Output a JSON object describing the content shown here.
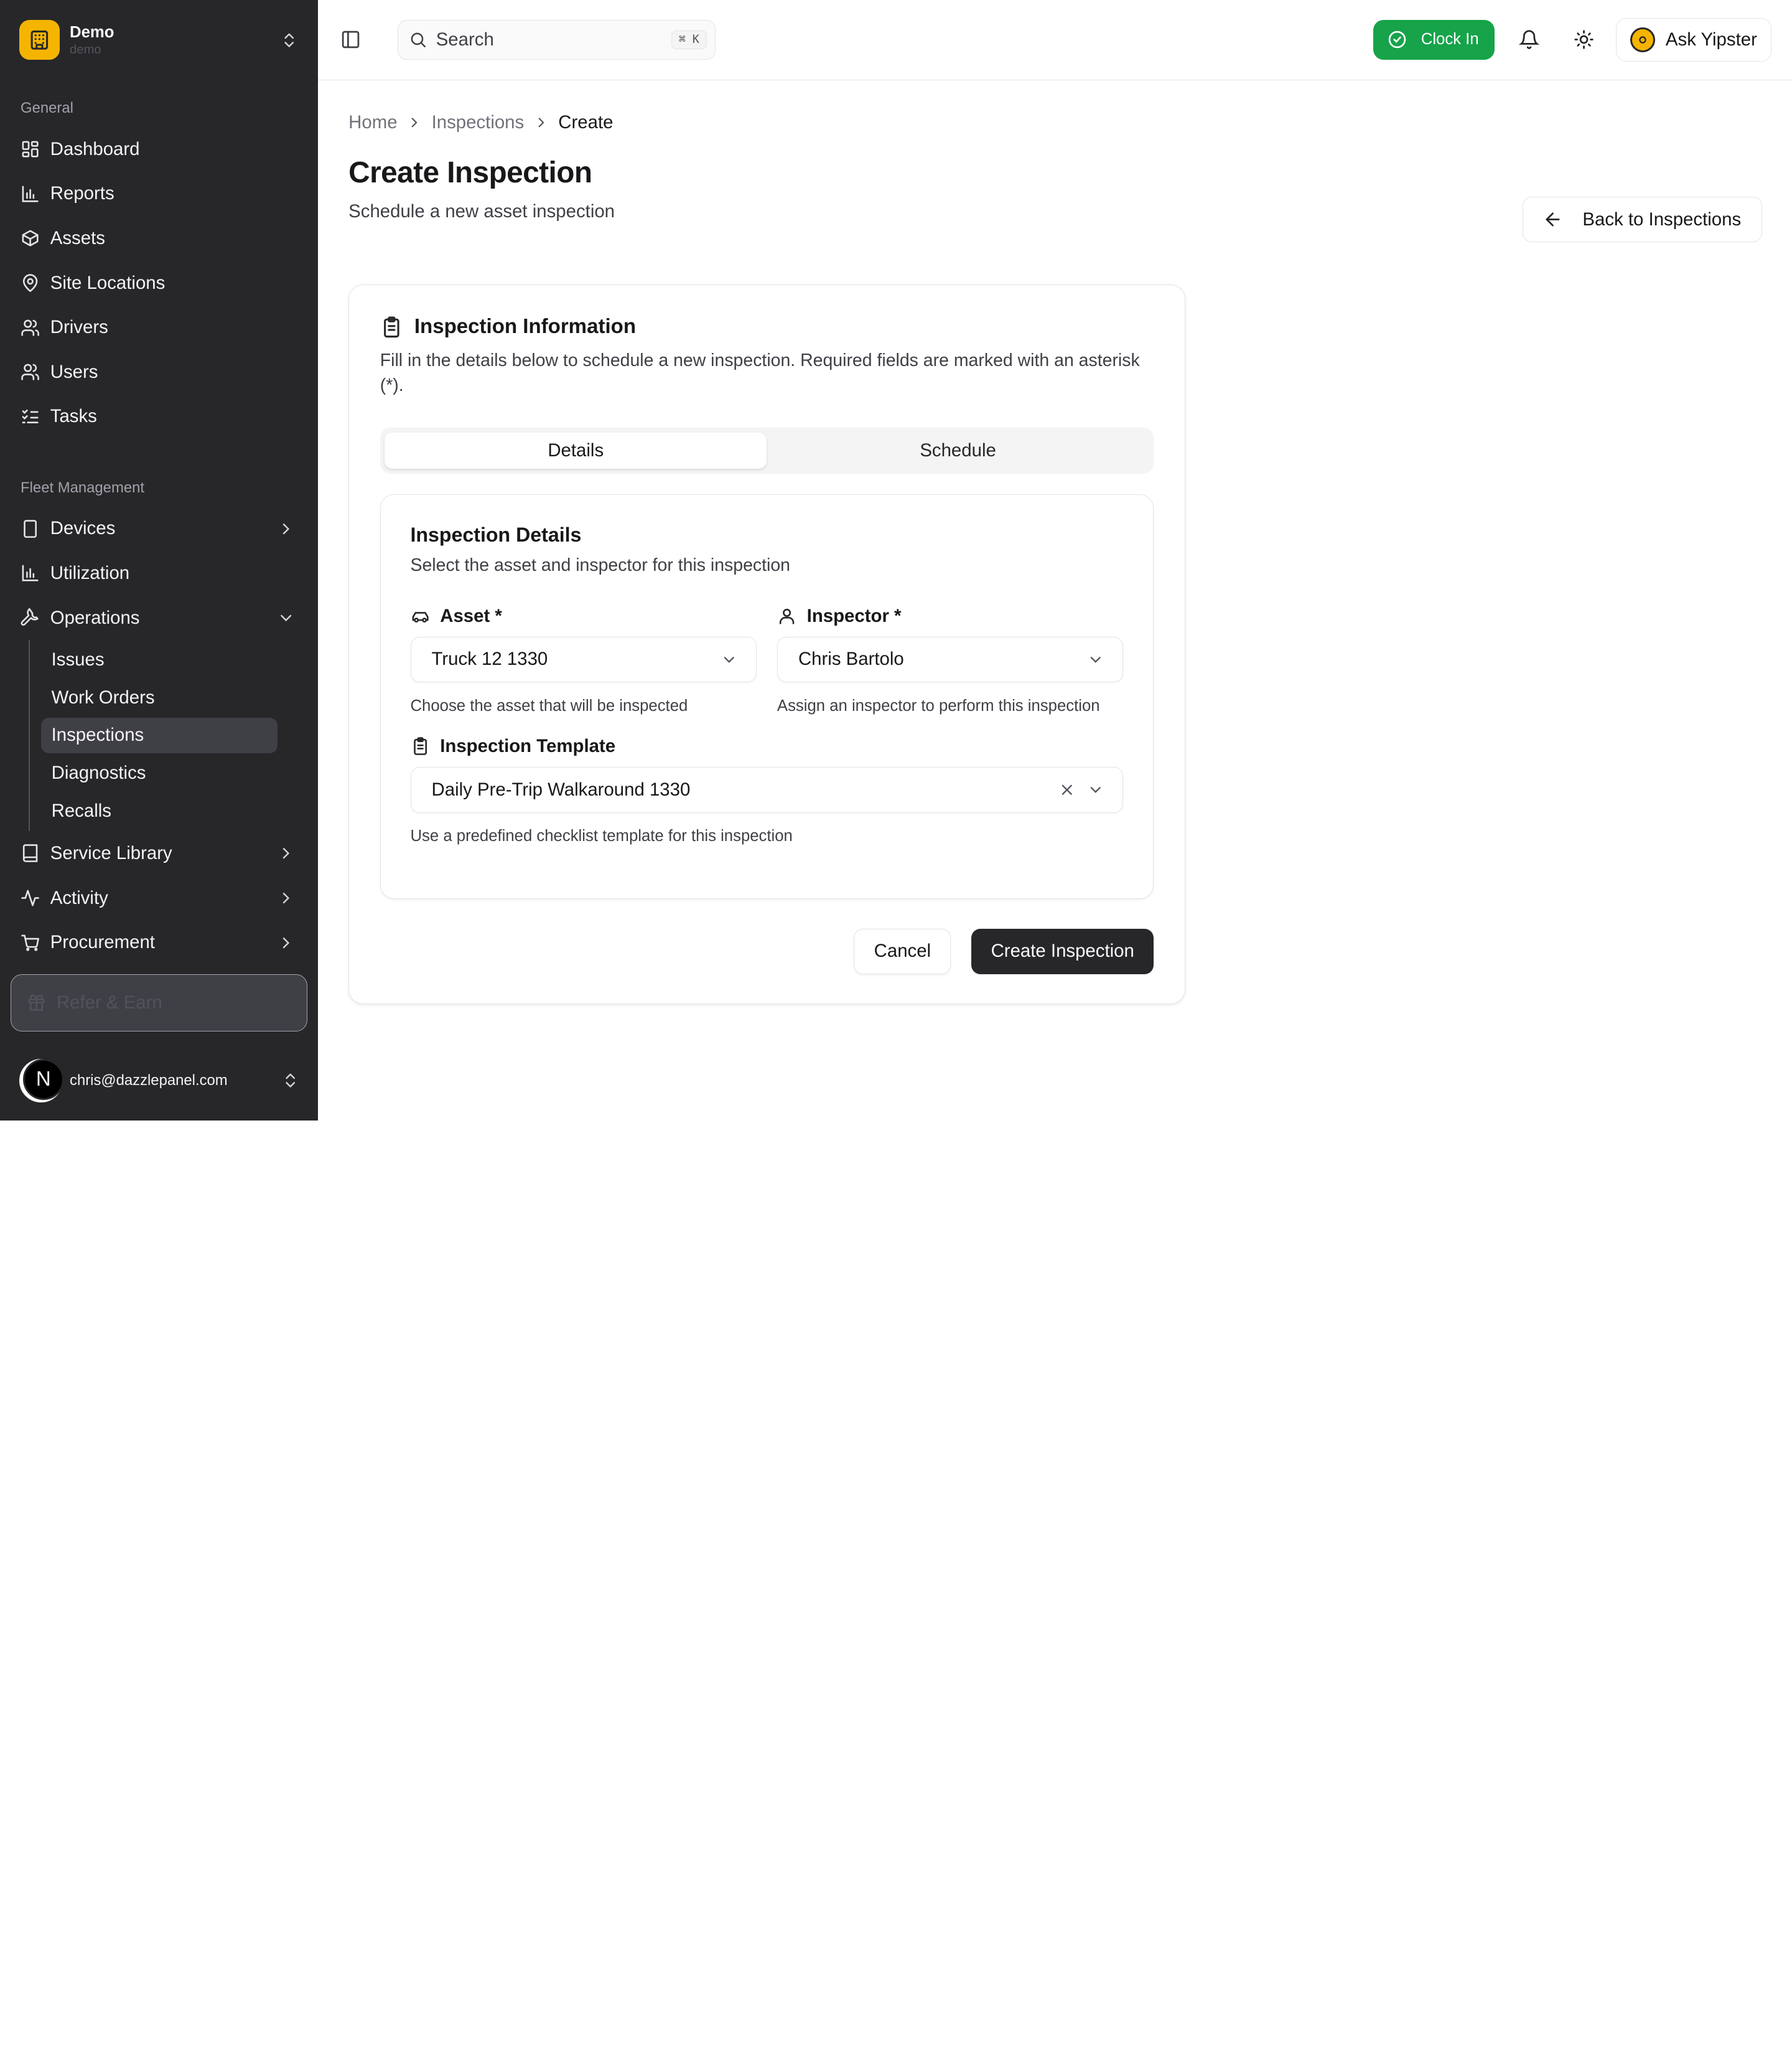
{
  "org": {
    "name": "Demo",
    "slug": "demo"
  },
  "sidebar": {
    "general_label": "General",
    "general_items": [
      {
        "label": "Dashboard",
        "icon": "dashboard-icon"
      },
      {
        "label": "Reports",
        "icon": "chart-icon"
      },
      {
        "label": "Assets",
        "icon": "box-icon"
      },
      {
        "label": "Site Locations",
        "icon": "map-pin-icon"
      },
      {
        "label": "Drivers",
        "icon": "users-icon"
      },
      {
        "label": "Users",
        "icon": "users-icon"
      },
      {
        "label": "Tasks",
        "icon": "list-checks-icon"
      }
    ],
    "fleet_label": "Fleet Management",
    "fleet_items": [
      {
        "label": "Devices",
        "icon": "tablet-icon"
      },
      {
        "label": "Utilization",
        "icon": "chart-icon"
      },
      {
        "label": "Operations",
        "icon": "wrench-icon"
      }
    ],
    "operations_subitems": [
      {
        "label": "Issues"
      },
      {
        "label": "Work Orders"
      },
      {
        "label": "Inspections",
        "active": true
      },
      {
        "label": "Diagnostics"
      },
      {
        "label": "Recalls"
      }
    ],
    "more_items": [
      {
        "label": "Service Library",
        "icon": "book-icon"
      },
      {
        "label": "Activity",
        "icon": "activity-icon"
      },
      {
        "label": "Procurement",
        "icon": "cart-icon"
      }
    ],
    "refer_label": "Refer & Earn",
    "user_email": "chris@dazzlepanel.com",
    "user_avatar_letter": "N"
  },
  "topbar": {
    "search_label": "Search",
    "search_shortcut": "⌘ K",
    "clock_in_label": "Clock In",
    "ask_label": "Ask Yipster"
  },
  "breadcrumb": {
    "home": "Home",
    "section": "Inspections",
    "current": "Create"
  },
  "page": {
    "title": "Create Inspection",
    "subtitle": "Schedule a new asset inspection",
    "back_label": "Back to Inspections"
  },
  "card": {
    "title": "Inspection Information",
    "description": "Fill in the details below to schedule a new inspection. Required fields are marked with an asterisk (*).",
    "tabs": [
      {
        "label": "Details",
        "active": true
      },
      {
        "label": "Schedule",
        "active": false
      }
    ]
  },
  "details": {
    "title": "Inspection Details",
    "description": "Select the asset and inspector for this inspection",
    "asset": {
      "label": "Asset *",
      "value": "Truck 12 1330",
      "help": "Choose the asset that will be inspected"
    },
    "inspector": {
      "label": "Inspector *",
      "value": "Chris Bartolo",
      "help": "Assign an inspector to perform this inspection"
    },
    "template": {
      "label": "Inspection Template",
      "value": "Daily Pre-Trip Walkaround 1330",
      "help": "Use a predefined checklist template for this inspection"
    }
  },
  "actions": {
    "cancel": "Cancel",
    "submit": "Create Inspection"
  },
  "colors": {
    "sidebar_bg": "#27272a",
    "accent_green": "#16a34a",
    "brand_yellow": "#f5b400",
    "primary_btn": "#27272a"
  }
}
